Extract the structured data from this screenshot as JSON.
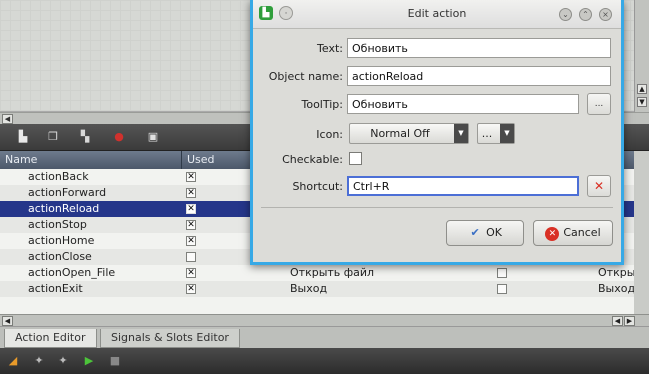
{
  "dialog": {
    "title": "Edit action",
    "fields": {
      "text": {
        "label": "Text:",
        "value": "Обновить"
      },
      "object_name": {
        "label": "Object name:",
        "value": "actionReload"
      },
      "tooltip": {
        "label": "ToolTip:",
        "value": "Обновить",
        "button": "..."
      },
      "icon": {
        "label": "Icon:",
        "mode": "Normal Off",
        "button": "..."
      },
      "checkable": {
        "label": "Checkable:",
        "checked": false
      },
      "shortcut": {
        "label": "Shortcut:",
        "value": "Ctrl+R"
      }
    },
    "ok_label": "OK",
    "cancel_label": "Cancel"
  },
  "table": {
    "headers": {
      "name": "Name",
      "used": "Used"
    },
    "rows": [
      {
        "name": "actionBack",
        "used": true,
        "text": "",
        "checkable": false,
        "shortcut": ""
      },
      {
        "name": "actionForward",
        "used": true,
        "text": "",
        "checkable": false,
        "shortcut": ""
      },
      {
        "name": "actionReload",
        "used": true,
        "text": "",
        "checkable": false,
        "shortcut": "",
        "selected": true
      },
      {
        "name": "actionStop",
        "used": true,
        "text": "",
        "checkable": false,
        "shortcut": ""
      },
      {
        "name": "actionHome",
        "used": true,
        "text": "",
        "checkable": false,
        "shortcut": ""
      },
      {
        "name": "actionClose",
        "used": false,
        "text": "",
        "checkable": true,
        "shortcut": ""
      },
      {
        "name": "actionOpen_File",
        "used": true,
        "text": "Открыть файл",
        "checkable": true,
        "shortcut": "Откры"
      },
      {
        "name": "actionExit",
        "used": true,
        "text": "Выход",
        "checkable": true,
        "shortcut": "Выход"
      }
    ]
  },
  "tabs": [
    {
      "label": "Action Editor",
      "active": true
    },
    {
      "label": "Signals & Slots Editor",
      "active": false
    }
  ],
  "colors": {
    "dialog_border": "#37a9e6",
    "selection": "#25368a",
    "header": "#5a6678",
    "toolbar": "#444444",
    "cancel_red": "#d93025",
    "ok_blue": "#3a6fc4"
  }
}
